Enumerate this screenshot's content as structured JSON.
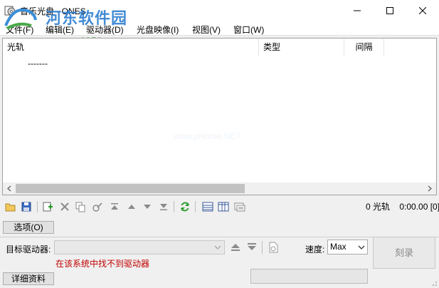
{
  "window": {
    "title": "音乐光盘 - ONES"
  },
  "watermark": {
    "brand": "河东软件园",
    "url": "www.pc0359.cn",
    "center": "www.pHome.NET"
  },
  "menu": [
    "文件(F)",
    "编辑(E)",
    "驱动器(D)",
    "光盘映像(I)",
    "视图(V)",
    "窗口(W)"
  ],
  "list": {
    "columns": [
      "光轨",
      "类型",
      "间隔"
    ],
    "rows": [
      {
        "track": "-------"
      }
    ]
  },
  "toolbar": {
    "icons": [
      "open-folder-icon",
      "save-icon",
      "add-track-icon",
      "delete-icon",
      "copy-icon",
      "edit-icon",
      "move-top-icon",
      "move-up-icon",
      "move-down-icon",
      "move-bottom-icon",
      "refresh-icon",
      "view-list-icon",
      "view-columns-icon",
      "view-details-icon"
    ],
    "status": "0 光轨    0:00.00 [0]"
  },
  "options": {
    "label": "选项(O)"
  },
  "drive": {
    "label": "目标驱动器:",
    "value": "",
    "error": "在该系统中找不到驱动器",
    "error_color": "#c00000"
  },
  "speed": {
    "label": "速度:",
    "value": "Max"
  },
  "burn": {
    "label": "刻录"
  },
  "details": {
    "label": "详细资料"
  }
}
